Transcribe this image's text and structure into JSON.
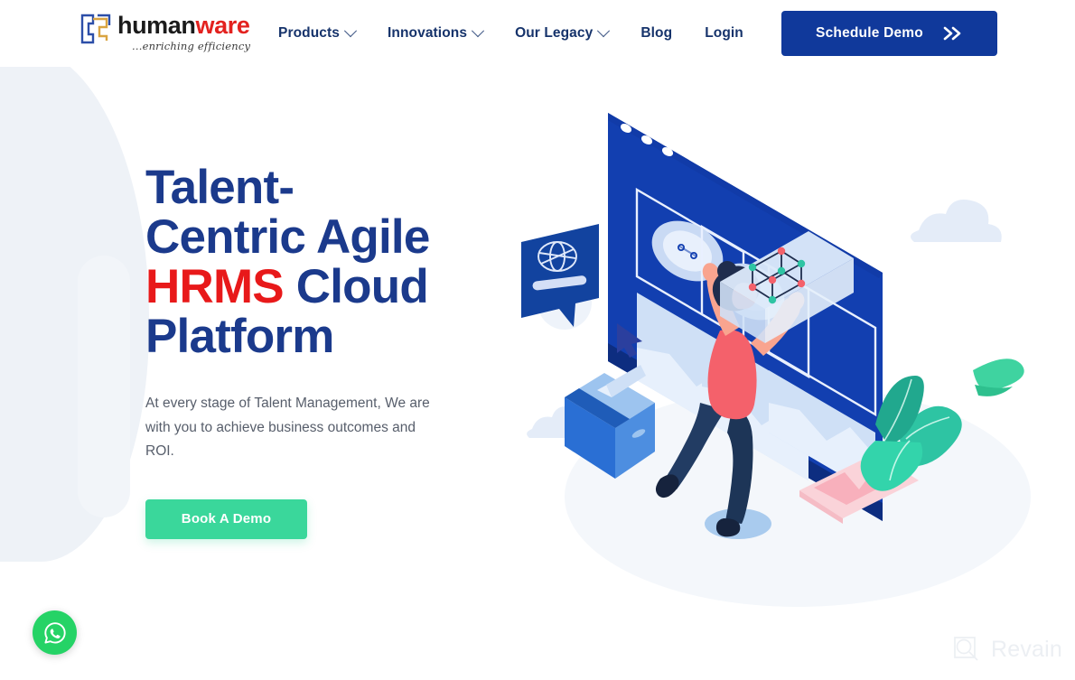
{
  "brand": {
    "logo_icon": "humanware-h-mark-icon",
    "name_part1": "human",
    "name_part2": "ware",
    "tagline": "...enriching efficiency",
    "colors": {
      "navy": "#16336b",
      "headline_navy": "#1b3a8c",
      "accent_red": "#e8191a",
      "button_blue": "#10399b",
      "button_green": "#3ad79b",
      "whatsapp_green": "#25d366"
    }
  },
  "nav": {
    "items": [
      {
        "label": "Products",
        "has_dropdown": true,
        "icon": "chevron-down-icon"
      },
      {
        "label": "Innovations",
        "has_dropdown": true,
        "icon": "chevron-down-icon"
      },
      {
        "label": "Our Legacy",
        "has_dropdown": true,
        "icon": "chevron-down-icon"
      },
      {
        "label": "Blog",
        "has_dropdown": false
      },
      {
        "label": "Login",
        "has_dropdown": false
      }
    ],
    "cta": {
      "label": "Schedule Demo",
      "icon": "double-chevron-right-icon"
    }
  },
  "hero": {
    "headline_line1": "Talent-",
    "headline_line2": "Centric Agile",
    "headline_accent": "HRMS",
    "headline_line3_rest": " Cloud",
    "headline_line4": "Platform",
    "subtitle": "At every stage of Talent Management, We are with you to achieve business outcomes and ROI.",
    "cta_label": "Book A Demo",
    "illustration": "isometric-hrms-dashboard-woman-illustration"
  },
  "floating": {
    "whatsapp_icon": "whatsapp-icon"
  },
  "watermark": {
    "icon": "revain-magnifier-icon",
    "label": "Revain"
  }
}
